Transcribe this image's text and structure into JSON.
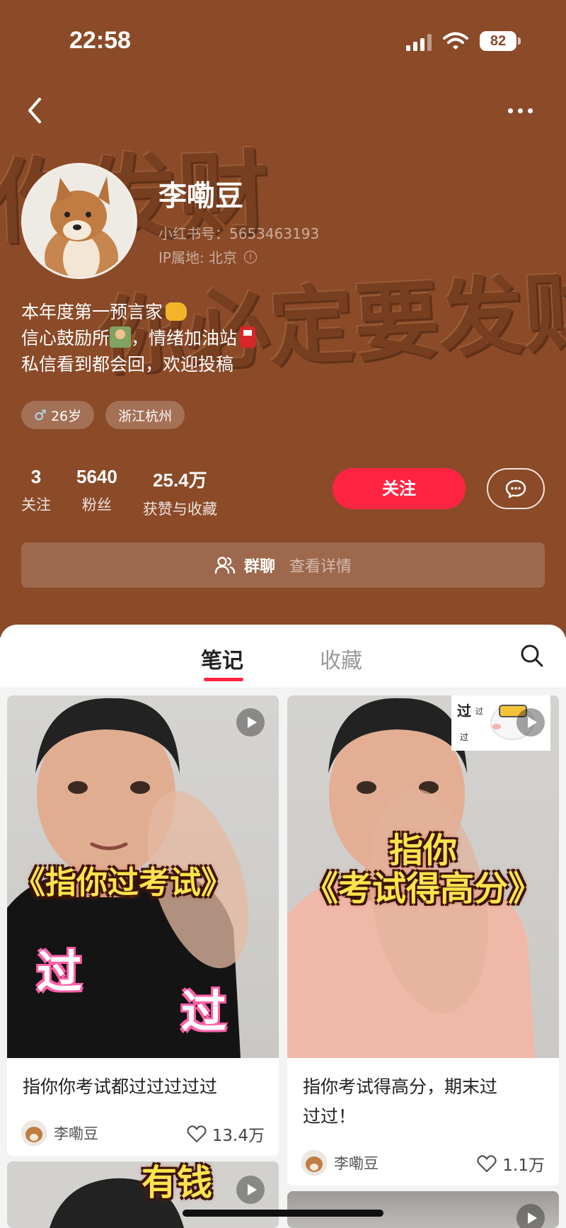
{
  "status_bar": {
    "time": "22:58",
    "battery": "82"
  },
  "background_text": {
    "line1": "你发财",
    "line2": "你必定要发财"
  },
  "profile": {
    "name": "李嘞豆",
    "uid_line": "小红书号：5653463193",
    "ip_line": "IP属地: 北京",
    "info_icon": "i",
    "bio": {
      "line1": "本年度第一预言家",
      "line2a": "信心鼓励所",
      "line2b": "，情绪加油站",
      "line3": "私信看到都会回，欢迎投稿"
    },
    "tags": [
      {
        "icon": "male-icon",
        "symbol": "♂",
        "label": "26岁"
      },
      {
        "label": "浙江杭州"
      }
    ]
  },
  "stats": [
    {
      "value": "3",
      "label": "关注"
    },
    {
      "value": "5640",
      "label": "粉丝"
    },
    {
      "value": "25.4万",
      "label": "获赞与收藏"
    }
  ],
  "buttons": {
    "follow": "关注"
  },
  "group_chat": {
    "title": "群聊",
    "detail": "查看详情"
  },
  "tabs": {
    "notes": "笔记",
    "favorites": "收藏"
  },
  "cards": [
    {
      "overlay": "《指你过考试》",
      "pass1": "过",
      "pass2": "过",
      "title": "指你你考试都过过过过过",
      "author": "李嘞豆",
      "likes": "13.4万"
    },
    {
      "overlay_line1": "指你",
      "overlay_line2": "《考试得高分》",
      "sticker_text1": "过",
      "sticker_text2": "过",
      "sticker_text3": "过",
      "title_line1": "指你考试得高分，期末过",
      "title_line2": "过过！",
      "author": "李嘞豆",
      "likes": "1.1万"
    }
  ],
  "partial_card": {
    "overlay": "有钱"
  },
  "colors": {
    "header_bg": "#8b4a28",
    "accent": "#ff2442",
    "card_bg": "#ffffff"
  }
}
